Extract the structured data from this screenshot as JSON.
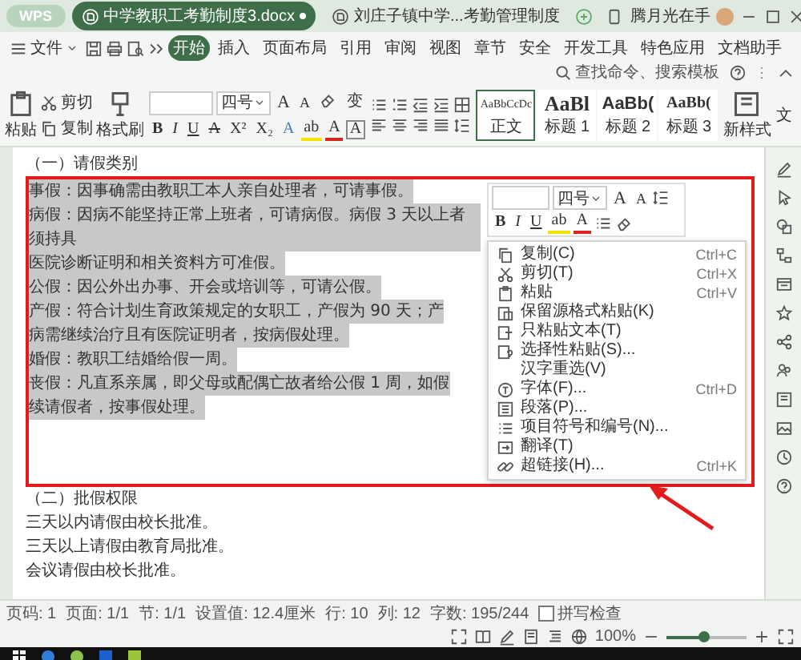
{
  "title_bar": {
    "app_button": "WPS",
    "tabs": [
      {
        "label": "中学教职工考勤制度3.docx",
        "selected": true
      },
      {
        "label": "刘庄子镇中学...考勤管理制度",
        "selected": false
      }
    ],
    "user": "腾月光在手"
  },
  "file_menu": "文件",
  "ribbon_tabs": [
    {
      "label": "开始",
      "selected": true
    },
    {
      "label": "插入",
      "selected": false
    },
    {
      "label": "页面布局",
      "selected": false
    },
    {
      "label": "引用",
      "selected": false
    },
    {
      "label": "审阅",
      "selected": false
    },
    {
      "label": "视图",
      "selected": false
    },
    {
      "label": "章节",
      "selected": false
    },
    {
      "label": "安全",
      "selected": false
    },
    {
      "label": "开发工具",
      "selected": false
    },
    {
      "label": "特色应用",
      "selected": false
    },
    {
      "label": "文档助手",
      "selected": false
    }
  ],
  "search": {
    "placeholder": "查找命令、搜索模板"
  },
  "toolbar": {
    "paste": "粘贴",
    "cut": "剪切",
    "copy": "复制",
    "format_painter": "格式刷",
    "font_size": "四号",
    "font_buttons": [
      {
        "kind": "grow",
        "text": "A"
      },
      {
        "kind": "shrink",
        "text": "A"
      },
      {
        "kind": "clear"
      },
      {
        "kind": "phonetic",
        "text": "变"
      }
    ],
    "format_buttons": [
      {
        "kind": "bold",
        "text": "B"
      },
      {
        "kind": "italic",
        "text": "I"
      },
      {
        "kind": "underline",
        "text": "U"
      },
      {
        "kind": "strike",
        "text": "A"
      },
      {
        "kind": "plain",
        "text": "X²"
      },
      {
        "kind": "plain",
        "text": "X₂"
      },
      {
        "kind": "effect",
        "text": "A"
      },
      {
        "kind": "highlight",
        "text": "ab"
      },
      {
        "kind": "color",
        "text": "A"
      },
      {
        "kind": "border",
        "text": "A"
      }
    ],
    "styles": [
      {
        "preview": "AaBbCcDc",
        "label": "正文",
        "kind": "body",
        "selected": true
      },
      {
        "preview": "AaBl",
        "label": "标题 1",
        "kind": "h1",
        "selected": false
      },
      {
        "preview": "AaBb(",
        "label": "标题 2",
        "kind": "h2",
        "selected": false
      },
      {
        "preview": "AaBb(",
        "label": "标题 3",
        "kind": "h3",
        "selected": false
      }
    ],
    "new_style": "新样式",
    "more": "文"
  },
  "document": {
    "lines": [
      {
        "text": "（一）请假类别",
        "selected": false
      },
      {
        "text": "事假：因事确需由教职工本人亲自处理者，可请事假。",
        "selected": true
      },
      {
        "text": "病假：因病不能坚持正常上班者，可请病假。病假 3 天以上者须持具",
        "selected": true
      },
      {
        "text": "医院诊断证明和相关资料方可准假。",
        "selected": true
      },
      {
        "text": "公假：因公外出办事、开会或培训等，可请公假。",
        "selected": true
      },
      {
        "text": "产假：符合计划生育政策规定的女职工，产假为 90 天；产",
        "selected": true
      },
      {
        "text": "病需继续治疗且有医院证明者，按病假处理。",
        "selected": true
      },
      {
        "text": "婚假：教职工结婚给假一周。",
        "selected": true
      },
      {
        "text": "丧假：凡直系亲属，即父母或配偶亡故者给公假 1 周，如假",
        "selected": true
      },
      {
        "text": "续请假者，按事假处理。",
        "selected": true
      },
      {
        "text": "（二）批假权限",
        "selected": false
      },
      {
        "text": "三天以内请假由校长批准。",
        "selected": false
      },
      {
        "text": "三天以上请假由教育局批准。",
        "selected": false
      },
      {
        "text": "会议请假由校长批准。",
        "selected": false
      }
    ]
  },
  "mini_toolbar": {
    "font_size": "四号",
    "top_buttons": [
      {
        "kind": "grow",
        "text": "A"
      },
      {
        "kind": "shrink",
        "text": "A"
      }
    ],
    "buttons": [
      {
        "kind": "bold",
        "text": "B"
      },
      {
        "kind": "italic",
        "text": "I"
      },
      {
        "kind": "underline",
        "text": "U"
      },
      {
        "kind": "highlight",
        "text": "ab"
      },
      {
        "kind": "color",
        "text": "A"
      }
    ]
  },
  "context_menu": [
    {
      "kind": "copy",
      "label": "复制(C)",
      "shortcut": "Ctrl+C"
    },
    {
      "kind": "cut",
      "label": "剪切(T)",
      "shortcut": "Ctrl+X"
    },
    {
      "kind": "paste",
      "label": "粘贴",
      "shortcut": "Ctrl+V"
    },
    {
      "kind": "paste-keep",
      "label": "保留源格式粘贴(K)"
    },
    {
      "kind": "paste-text",
      "label": "只粘贴文本(T)"
    },
    {
      "kind": "paste-special",
      "label": "选择性粘贴(S)..."
    },
    {
      "kind": "plain",
      "label": "汉字重选(V)"
    },
    {
      "kind": "font",
      "label": "字体(F)...",
      "shortcut": "Ctrl+D"
    },
    {
      "kind": "paragraph",
      "label": "段落(P)..."
    },
    {
      "kind": "list",
      "label": "项目符号和编号(N)..."
    },
    {
      "kind": "translate",
      "label": "翻译(T)"
    },
    {
      "kind": "link",
      "label": "超链接(H)...",
      "shortcut": "Ctrl+K"
    }
  ],
  "status_bar": {
    "items": [
      "页码: 1",
      "页面: 1/1",
      "节: 1/1",
      "设置值: 12.4厘米",
      "行: 10",
      "列: 12",
      "字数: 195/244"
    ],
    "spell_check": {
      "label": "拼写检查",
      "checked": false
    },
    "zoom": "100%",
    "zoom_slider": {
      "level": 0.45
    }
  }
}
